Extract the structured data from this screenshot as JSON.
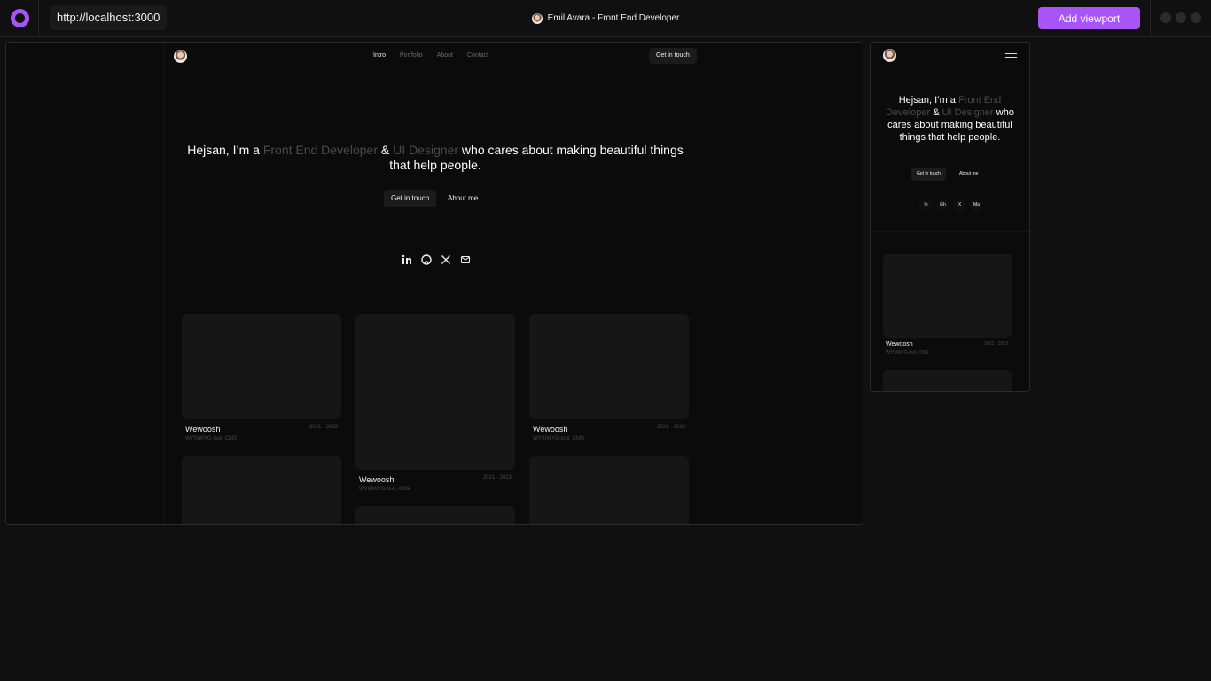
{
  "app": {
    "url": "http://localhost:3000",
    "page_title": "Emil Avara - Front End Developer",
    "add_viewport_label": "Add viewport",
    "accent_color": "#a855f7"
  },
  "site": {
    "nav": [
      "Intro",
      "Portfolio",
      "About",
      "Contact"
    ],
    "nav_cta": "Get in touch",
    "hero": {
      "p1": "Hejsan, I’m a ",
      "p2": "Front End Developer",
      "p3": " & ",
      "p4": "UI Designer",
      "p5": " who cares about making beautiful things that help people."
    },
    "cta_primary": "Get in touch",
    "cta_secondary": "About me",
    "social_icons": [
      "linkedin-icon",
      "github-icon",
      "x-icon",
      "mail-icon"
    ],
    "projects": [
      {
        "title": "Wewoosh",
        "subtitle": "WYSIWYG-tool, CMS",
        "years": "2021 - 2023"
      },
      {
        "title": "Wewoosh",
        "subtitle": "WYSIWYG-tool, CMS",
        "years": "2021 - 2023"
      },
      {
        "title": "Wewoosh",
        "subtitle": "WYSIWYG-tool, CMS",
        "years": "2021 - 2023"
      }
    ]
  },
  "mobile": {
    "cta_primary": "Get in touch",
    "cta_secondary": "About me",
    "socials": [
      "In",
      "Gh",
      "X",
      "Ma"
    ],
    "project": {
      "title": "Wewoosh",
      "subtitle": "WYSIWYG-tool, CMS",
      "years": "2021 - 2023"
    }
  }
}
